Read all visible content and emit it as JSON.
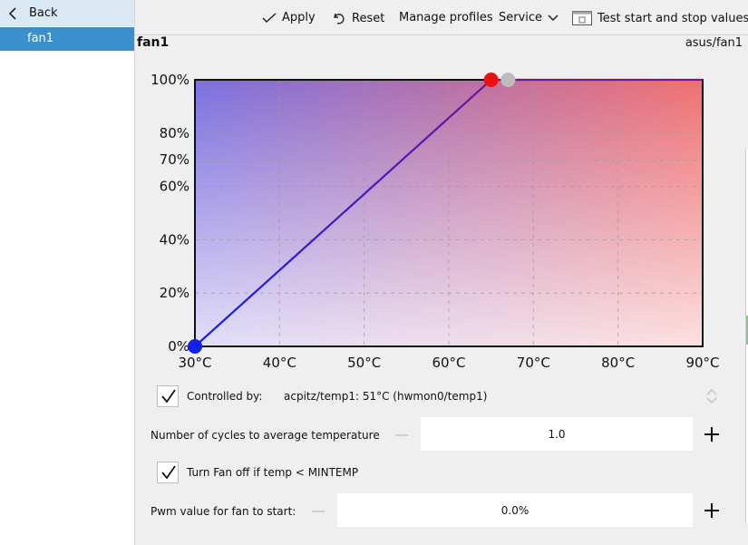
{
  "sidebar": {
    "back_label": "Back",
    "items": [
      {
        "label": "fan1",
        "selected": true
      }
    ]
  },
  "toolbar": {
    "apply_label": "Apply",
    "reset_label": "Reset",
    "manage_profiles_label": "Manage profiles",
    "service_label": "Service",
    "test_label": "Test start and stop values"
  },
  "header": {
    "title": "fan1",
    "device_path": "asus/fan1"
  },
  "chart_data": {
    "type": "line",
    "x": [
      30,
      65
    ],
    "y": [
      0,
      100
    ],
    "x_ticks": [
      "30°C",
      "40°C",
      "50°C",
      "60°C",
      "70°C",
      "80°C",
      "90°C"
    ],
    "y_ticks": [
      "0%",
      "20%",
      "40%",
      "60%",
      "70%",
      "80%",
      "100%"
    ],
    "xlim": [
      30,
      90
    ],
    "ylim": [
      0,
      100
    ],
    "grid": true,
    "curve_color": "#5a1ecc",
    "points": [
      {
        "x": 30,
        "y": 0,
        "color": "#1020ee"
      },
      {
        "x": 65,
        "y": 100,
        "color": "#ee1111"
      }
    ],
    "current_temp_marker": {
      "x": 67,
      "y": 100,
      "color": "#bdbdbd"
    }
  },
  "controls": {
    "controlled_by_label": "Controlled by:",
    "controlled_by_value": "acpitz/temp1: 51°C  (hwmon0/temp1)",
    "controlled_by_checked": true,
    "cycles_label": "Number of cycles to average temperature",
    "cycles_value": "1.0",
    "fan_off_label": "Turn Fan off if temp < MINTEMP",
    "fan_off_checked": true,
    "pwm_label": "Pwm value for fan to start:",
    "pwm_value": "0.0%"
  }
}
